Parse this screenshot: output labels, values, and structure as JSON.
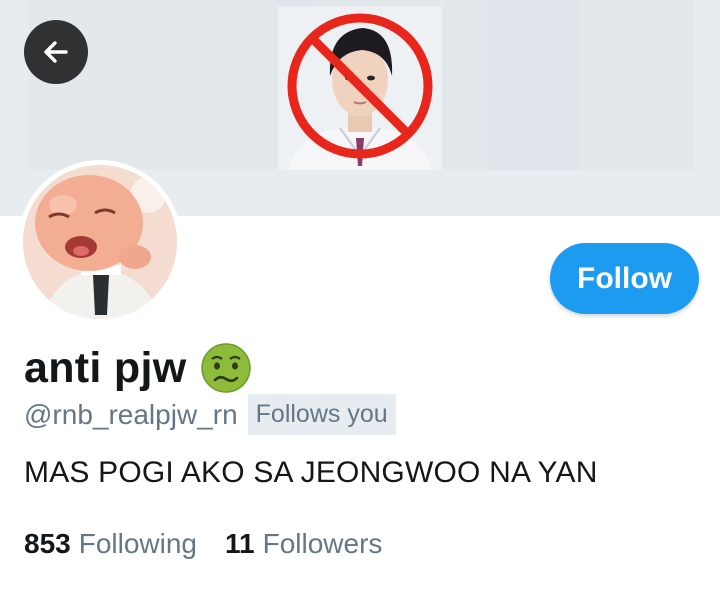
{
  "profile": {
    "display_name": "anti pjw",
    "handle": "@rnb_realpjw_rn",
    "follows_you_label": "Follows you",
    "bio": "MAS POGI AKO SA JEONGWOO NA YAN",
    "name_emoji_icon": "nauseated-face-icon"
  },
  "actions": {
    "follow_label": "Follow",
    "back_icon": "arrow-left-icon"
  },
  "stats": {
    "following_count": "853",
    "following_label": "Following",
    "followers_count": "11",
    "followers_label": "Followers"
  },
  "colors": {
    "accent": "#1d9bf0",
    "secondary_text": "#657786",
    "banner_bg": "#e6ecf0",
    "prohibition_red": "#e8261c"
  }
}
